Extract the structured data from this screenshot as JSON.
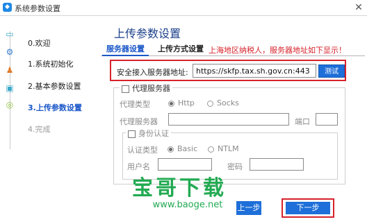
{
  "window": {
    "title": "系统参数设置"
  },
  "steps": [
    {
      "label": "0.欢迎",
      "state": "done",
      "icon": "laptop-icon"
    },
    {
      "label": "1.系统初始化",
      "state": "done",
      "icon": "gear-icon"
    },
    {
      "label": "2.基本参数设置",
      "state": "done",
      "icon": "user-icon"
    },
    {
      "label": "3.上传参数设置",
      "state": "active",
      "icon": "tray-icon"
    },
    {
      "label": "4.完成",
      "state": "pending",
      "icon": "check-circle-icon"
    }
  ],
  "page_title": "上传参数设置",
  "tabs": [
    {
      "label": "服务器设置",
      "active": true
    },
    {
      "label": "上传方式设置",
      "active": false
    }
  ],
  "notice": "上海地区纳税人，服务器地址如下显示！",
  "server": {
    "label": "安全接入服务器地址:",
    "address": "https://skfp.tax.sh.gov.cn:443",
    "test_button": "测试"
  },
  "proxy": {
    "legend": "代理服务器",
    "type_label": "代理类型",
    "options": [
      "Http",
      "Socks"
    ],
    "selected": "Http",
    "server_label": "代理服务器",
    "port_label": "端口",
    "auth": {
      "legend": "身份认证",
      "type_label": "认证类型",
      "options": [
        "Basic",
        "NTLM"
      ],
      "selected": "Basic",
      "username_label": "用户名",
      "password_label": "密码"
    }
  },
  "watermark": {
    "brand": "宝哥下载",
    "url": "www.baoge.net"
  },
  "footer": {
    "prev_button": "上一步",
    "next_button": "下一步"
  },
  "colors": {
    "accent": "#1e6fd9",
    "highlight_red": "#d6222a",
    "watermark_green": "#22aa52"
  }
}
